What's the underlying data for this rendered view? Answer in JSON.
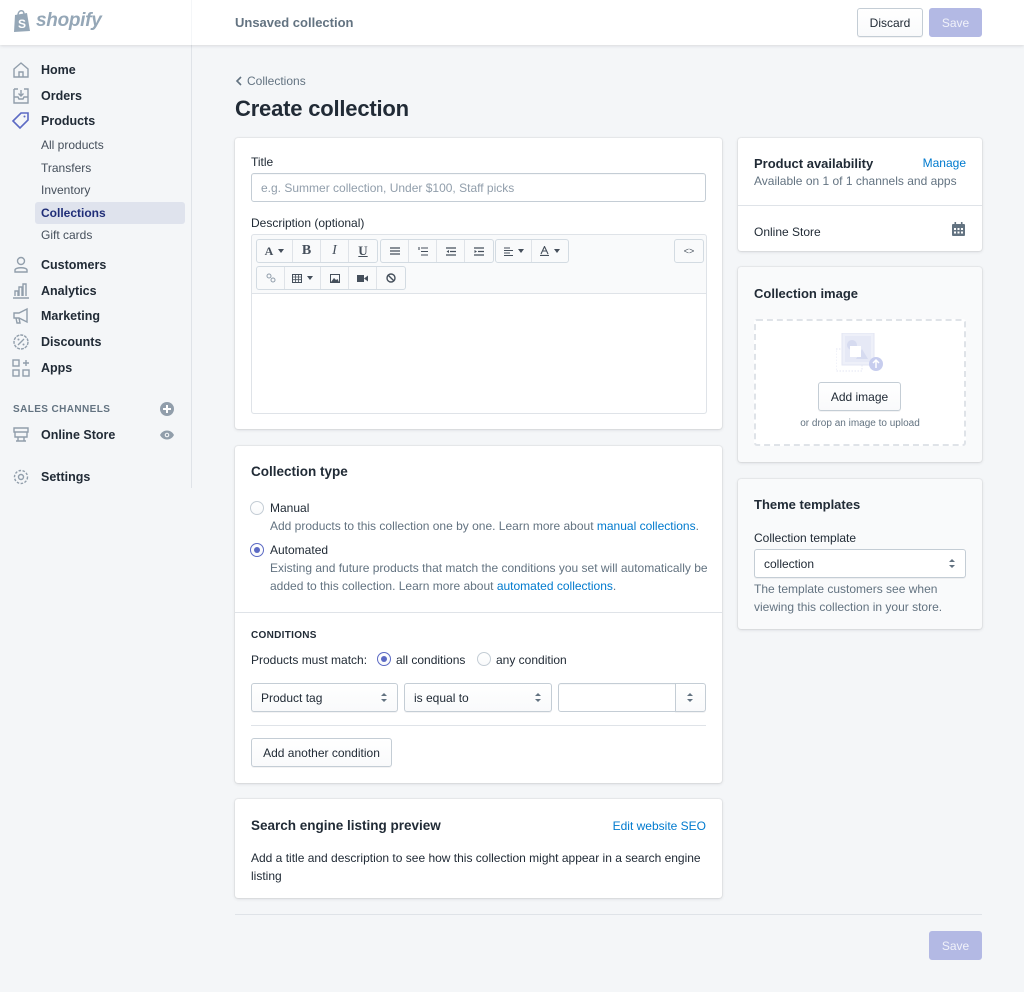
{
  "topbar": {
    "brand": "shopify",
    "title": "Unsaved collection",
    "discard_label": "Discard",
    "save_label": "Save"
  },
  "sidebar": {
    "items": [
      {
        "label": "Home",
        "icon": "home-icon"
      },
      {
        "label": "Orders",
        "icon": "orders-icon"
      },
      {
        "label": "Products",
        "icon": "tag-icon"
      }
    ],
    "product_subitems": [
      {
        "label": "All products"
      },
      {
        "label": "Transfers"
      },
      {
        "label": "Inventory"
      },
      {
        "label": "Collections",
        "active": true
      },
      {
        "label": "Gift cards"
      }
    ],
    "items2": [
      {
        "label": "Customers",
        "icon": "customers-icon"
      },
      {
        "label": "Analytics",
        "icon": "analytics-icon"
      },
      {
        "label": "Marketing",
        "icon": "megaphone-icon"
      },
      {
        "label": "Discounts",
        "icon": "discount-icon"
      },
      {
        "label": "Apps",
        "icon": "apps-icon"
      }
    ],
    "sales_channels_label": "SALES CHANNELS",
    "online_store_label": "Online Store",
    "settings_label": "Settings"
  },
  "main": {
    "breadcrumb": "Collections",
    "page_title": "Create collection",
    "title_card": {
      "title_label": "Title",
      "title_value": "",
      "title_placeholder": "e.g. Summer collection, Under $100, Staff picks",
      "description_label": "Description (optional)",
      "toolbar_row1": [
        "font",
        "bold",
        "italic",
        "underline",
        "bullet-list",
        "numbered-list",
        "outdent",
        "indent",
        "align",
        "text-color"
      ],
      "toolbar_row2": [
        "link",
        "table",
        "image",
        "video",
        "clear-formatting"
      ],
      "html_toggle": "<>",
      "font_glyph": "A",
      "bold_glyph": "B",
      "italic_glyph": "I",
      "underline_glyph": "U"
    },
    "collection_type": {
      "heading": "Collection type",
      "manual_label": "Manual",
      "manual_help": "Add products to this collection one by one. Learn more about ",
      "manual_link": "manual collections",
      "automated_label": "Automated",
      "automated_help": "Existing and future products that match the conditions you set will automatically be added to this collection. Learn more about ",
      "automated_link": "automated collections",
      "selected": "Automated",
      "conditions_heading": "CONDITIONS",
      "match_label": "Products must match:",
      "match_all": "all conditions",
      "match_any": "any condition",
      "match_selected": "all conditions",
      "condition_field": "Product tag",
      "condition_operator": "is equal to",
      "condition_value": "",
      "add_condition_label": "Add another condition"
    },
    "seo": {
      "heading": "Search engine listing preview",
      "edit_link": "Edit website SEO",
      "body": "Add a title and description to see how this collection might appear in a search engine listing"
    }
  },
  "aside": {
    "availability": {
      "heading": "Product availability",
      "manage_link": "Manage",
      "subtitle": "Available on 1 of 1 channels and apps",
      "channel": "Online Store"
    },
    "image": {
      "heading": "Collection image",
      "add_label": "Add image",
      "drop_hint": "or drop an image to upload"
    },
    "theme": {
      "heading": "Theme templates",
      "template_label": "Collection template",
      "template_value": "collection",
      "help": "The template customers see when viewing this collection in your store."
    }
  },
  "footer": {
    "save_label": "Save"
  },
  "colors": {
    "accent": "#5c6ac4",
    "accent_disabled": "#b3b9e4",
    "link": "#007ace",
    "active_nav_bg": "#dfe3ed",
    "active_nav_text": "#202e78"
  }
}
